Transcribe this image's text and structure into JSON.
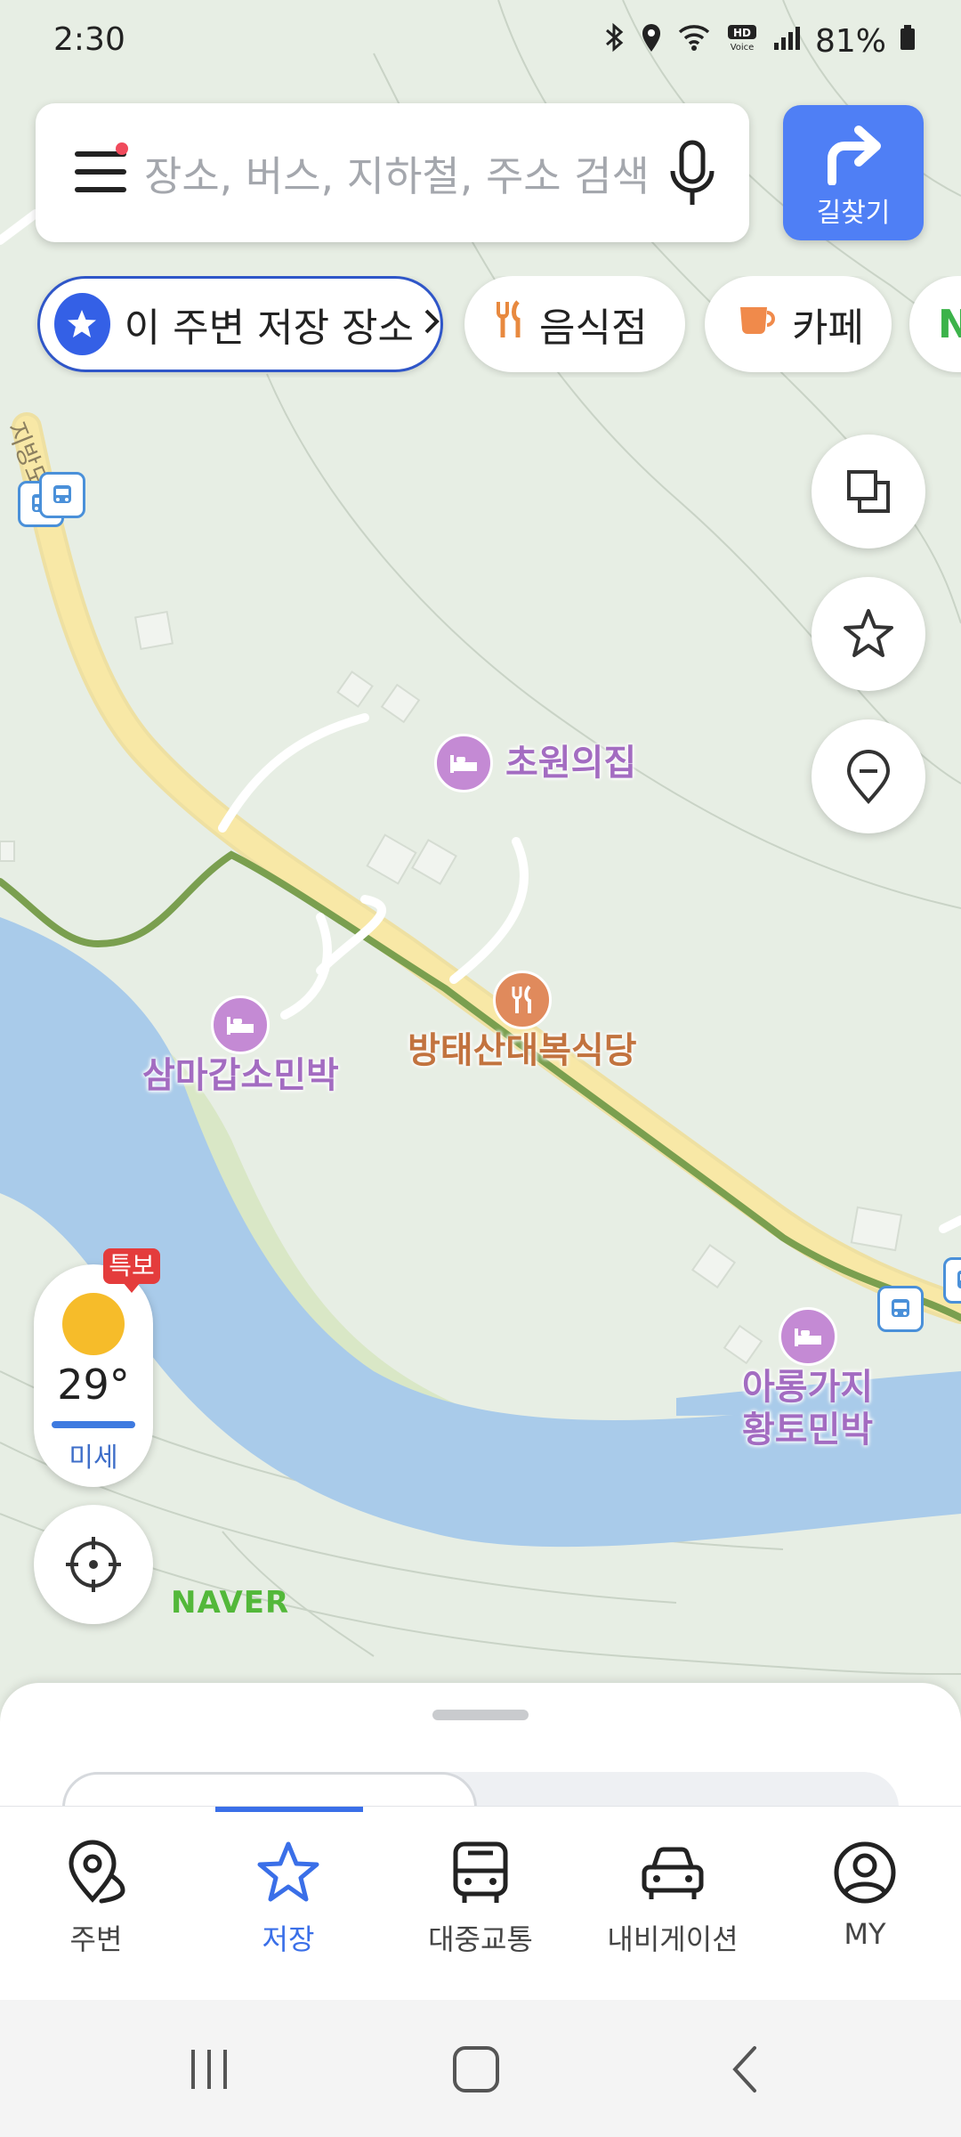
{
  "status_bar": {
    "time": "2:30",
    "battery": "81%",
    "icons": [
      "bluetooth-icon",
      "location-icon",
      "wifi-icon",
      "hd-voice-icon",
      "signal-icon",
      "battery-icon"
    ]
  },
  "search": {
    "placeholder": "장소, 버스, 지하철, 주소 검색",
    "directions_label": "길찾기"
  },
  "chips": [
    {
      "label": "이 주변 저장 장소",
      "icon": "star-icon"
    },
    {
      "label": "음식점",
      "icon": "fork-knife-icon"
    },
    {
      "label": "카페",
      "icon": "cup-icon"
    },
    {
      "label": "N",
      "icon": ""
    }
  ],
  "map": {
    "pois": [
      {
        "name": "초원의집",
        "type": "lodging"
      },
      {
        "name": "방태산대복식당",
        "type": "restaurant"
      },
      {
        "name": "삼마갑소민박",
        "type": "lodging"
      },
      {
        "name": "아롱가지\n황토민박",
        "type": "lodging"
      }
    ],
    "road_label": "지방도",
    "logo": "NAVER"
  },
  "weather": {
    "alert": "특보",
    "temperature": "29°",
    "dust": "미세"
  },
  "bottom_nav": {
    "items": [
      {
        "label": "주변",
        "icon": "location-pin-icon",
        "active": false
      },
      {
        "label": "저장",
        "icon": "star-icon",
        "active": true
      },
      {
        "label": "대중교통",
        "icon": "bus-icon",
        "active": false
      },
      {
        "label": "내비게이션",
        "icon": "car-icon",
        "active": false
      },
      {
        "label": "MY",
        "icon": "profile-icon",
        "active": false
      }
    ]
  },
  "colors": {
    "accent": "#4f7ff5",
    "lodging": "#c48ad4",
    "restaurant": "#e08a5c",
    "water": "#a8ccec",
    "road": "#f7e39a",
    "trail": "#7aa050"
  }
}
